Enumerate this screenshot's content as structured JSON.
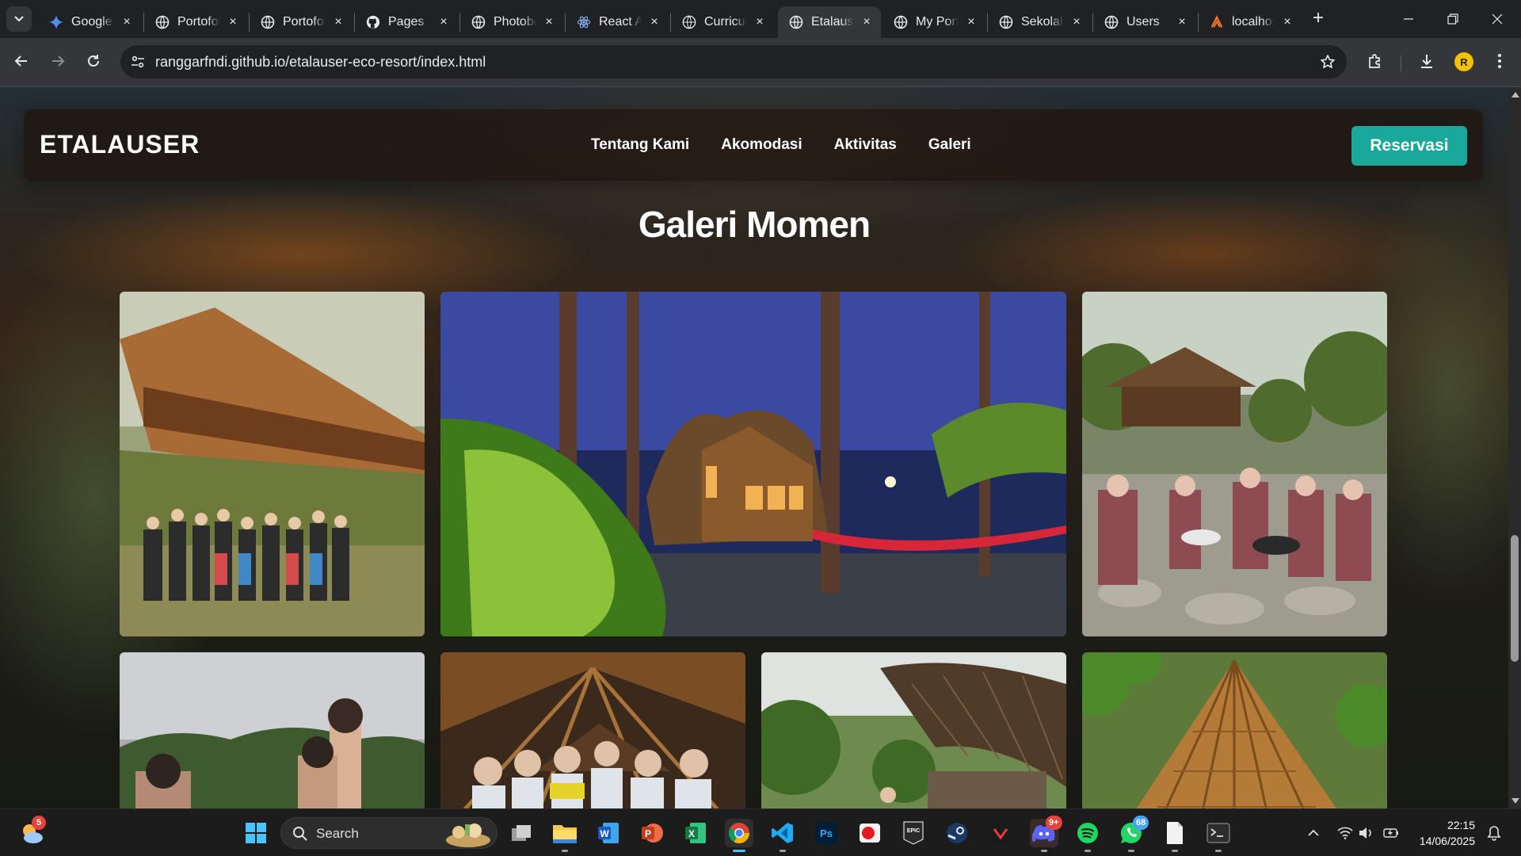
{
  "browser": {
    "tabs": [
      {
        "label": "Google",
        "icon": "gemini-icon",
        "active": false
      },
      {
        "label": "Portofolio",
        "icon": "globe-icon",
        "active": false
      },
      {
        "label": "Portofolio",
        "icon": "globe-icon",
        "active": false
      },
      {
        "label": "Pages",
        "icon": "github-icon",
        "active": false
      },
      {
        "label": "Photobooth",
        "icon": "globe-icon",
        "active": false
      },
      {
        "label": "React App",
        "icon": "react-icon",
        "active": false
      },
      {
        "label": "Curriculum",
        "icon": "globe-dark-icon",
        "active": false
      },
      {
        "label": "Etalauser",
        "icon": "globe-icon",
        "active": true
      },
      {
        "label": "My Portfolio",
        "icon": "globe-icon",
        "active": false
      },
      {
        "label": "Sekolah",
        "icon": "globe-icon",
        "active": false
      },
      {
        "label": "Users",
        "icon": "globe-icon",
        "active": false
      },
      {
        "label": "localhost",
        "icon": "xampp-icon",
        "active": false
      }
    ],
    "url": "ranggarfndi.github.io/etalauser-eco-resort/index.html",
    "profile_initial": "R"
  },
  "site": {
    "brand": "ETALAUSER",
    "nav": [
      "Tentang Kami",
      "Akomodasi",
      "Aktivitas",
      "Galeri"
    ],
    "cta": "Reservasi",
    "accent": "#1aa89a"
  },
  "gallery": {
    "title": "Galeri Momen",
    "photos": [
      {
        "subject": "group-photo-bamboo-hut"
      },
      {
        "subject": "bamboo-cottage-night-hammock"
      },
      {
        "subject": "scouts-picnic-gazebo"
      },
      {
        "subject": "children-sky-trees"
      },
      {
        "subject": "group-under-bamboo-roof"
      },
      {
        "subject": "thatched-roof-jungle"
      },
      {
        "subject": "thatched-roof-closeup"
      }
    ]
  },
  "taskbar": {
    "search_label": "Search",
    "weather_badge": "5",
    "discord_badge": "9+",
    "whatsapp_badge": "68",
    "time": "22:15",
    "date": "14/06/2025"
  }
}
